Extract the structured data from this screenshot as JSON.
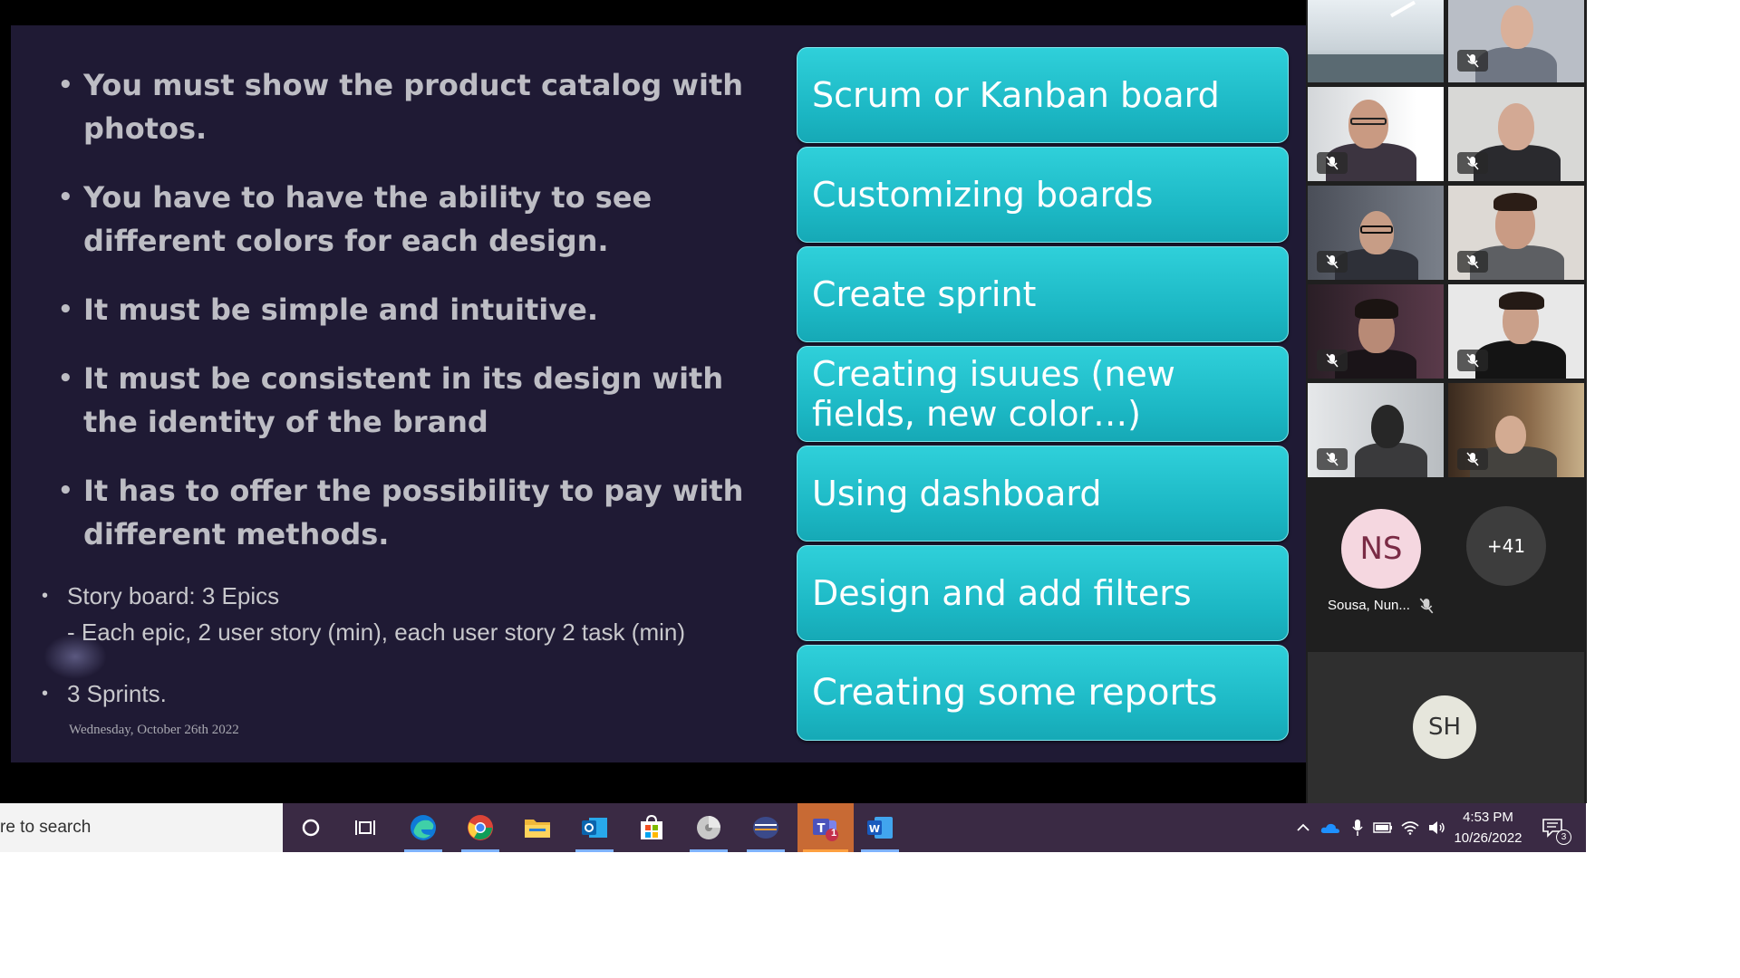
{
  "slide": {
    "bullets": [
      "You must show the product catalog with photos.",
      "You have to have the ability to see different colors for each design.",
      "It must be simple and intuitive.",
      "It must be consistent in its design with the identity of the brand",
      "It has to offer the possibility to pay with different methods."
    ],
    "small_bullets": [
      {
        "text": "Story board: 3 Epics",
        "sub": "- Each epic, 2 user story (min), each user story 2 task (min)"
      },
      {
        "text": "3 Sprints.",
        "sub": ""
      }
    ],
    "bullet_symbol": "•",
    "date": "Wednesday, October 26th 2022",
    "topics": [
      "Scrum or Kanban board",
      "Customizing boards",
      "Create sprint",
      "Creating isuues (new fields, new color…)",
      "Using dashboard",
      "Design and add filters",
      "Creating some reports"
    ],
    "colors": {
      "background": "#1f1a34",
      "topic_box": "#1bb6c3",
      "bullet_text": "#bdbdc4"
    }
  },
  "participants": {
    "video_tiles_muted": true,
    "ns": {
      "initials": "NS",
      "name": "Sousa, Nun...",
      "color": "#f5d7e0"
    },
    "more": {
      "label": "+41"
    },
    "sh": {
      "initials": "SH",
      "color": "#e6e6dc"
    }
  },
  "taskbar": {
    "search_placeholder": "re to search",
    "apps": [
      "cortana-icon",
      "task-view-icon",
      "edge-icon",
      "chrome-icon",
      "file-explorer-icon",
      "outlook-icon",
      "microsoft-store-icon",
      "app-disc-icon",
      "app-lines-icon",
      "teams-icon",
      "word-icon"
    ],
    "teams_badge": "1",
    "time": "4:53 PM",
    "date": "10/26/2022",
    "notification_count": "3"
  }
}
